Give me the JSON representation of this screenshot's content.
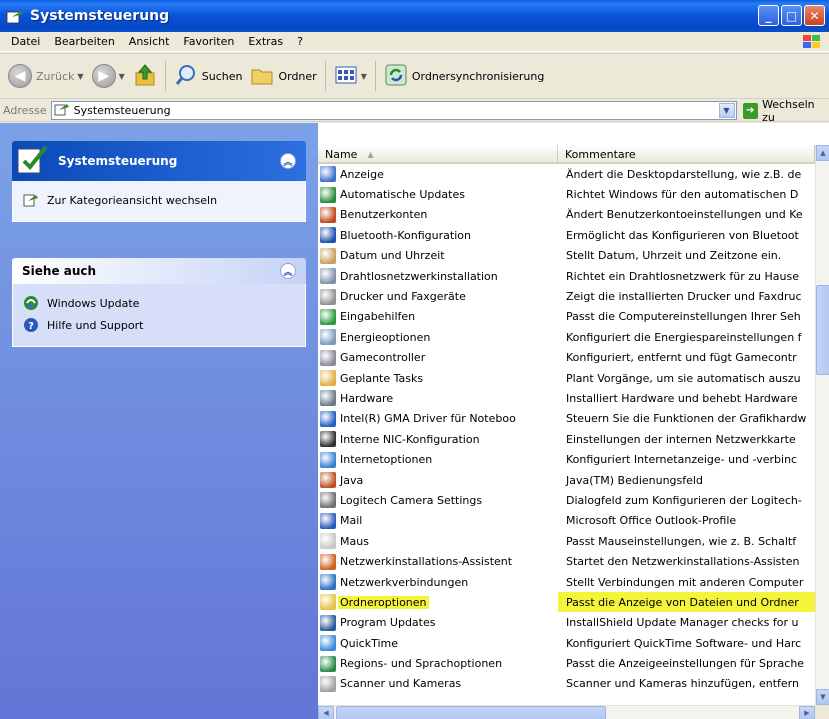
{
  "window": {
    "title": "Systemsteuerung"
  },
  "menu": [
    "Datei",
    "Bearbeiten",
    "Ansicht",
    "Favoriten",
    "Extras",
    "?"
  ],
  "toolbar": {
    "back": "Zurück",
    "search": "Suchen",
    "folders": "Ordner",
    "sync": "Ordnersynchronisierung"
  },
  "address": {
    "label": "Adresse",
    "value": "Systemsteuerung",
    "go": "Wechseln zu"
  },
  "leftpane": {
    "panel1": {
      "title": "Systemsteuerung",
      "link": "Zur Kategorieansicht wechseln"
    },
    "panel2": {
      "title": "Siehe auch",
      "links": [
        "Windows Update",
        "Hilfe und Support"
      ]
    }
  },
  "columns": {
    "name": "Name",
    "comment": "Kommentare"
  },
  "items": [
    {
      "name": "Anzeige",
      "comment": "Ändert die Desktopdarstellung, wie z.B. de",
      "icon": "display-icon",
      "color": "#3a6fd0"
    },
    {
      "name": "Automatische Updates",
      "comment": "Richtet Windows für den automatischen D",
      "icon": "updates-icon",
      "color": "#2a8a3a"
    },
    {
      "name": "Benutzerkonten",
      "comment": "Ändert Benutzerkontoeinstellungen und Ke",
      "icon": "users-icon",
      "color": "#c04a20"
    },
    {
      "name": "Bluetooth-Konfiguration",
      "comment": "Ermöglicht das Konfigurieren von Bluetoot",
      "icon": "bluetooth-icon",
      "color": "#1f4fb0"
    },
    {
      "name": "Datum und Uhrzeit",
      "comment": "Stellt Datum, Uhrzeit und Zeitzone ein.",
      "icon": "clock-icon",
      "color": "#c8a060"
    },
    {
      "name": "Drahtlosnetzwerkinstallation",
      "comment": "Richtet ein Drahtlosnetzwerk für zu Hause",
      "icon": "wireless-icon",
      "color": "#8090a8"
    },
    {
      "name": "Drucker und Faxgeräte",
      "comment": "Zeigt die installierten Drucker und Faxdruc",
      "icon": "printer-icon",
      "color": "#909090"
    },
    {
      "name": "Eingabehilfen",
      "comment": "Passt die Computereinstellungen Ihrer Seh",
      "icon": "accessibility-icon",
      "color": "#2a9a40"
    },
    {
      "name": "Energieoptionen",
      "comment": "Konfiguriert die Energiespareinstellungen f",
      "icon": "power-icon",
      "color": "#7a9ab8"
    },
    {
      "name": "Gamecontroller",
      "comment": "Konfiguriert, entfernt und fügt Gamecontr",
      "icon": "gamepad-icon",
      "color": "#8a8a9a"
    },
    {
      "name": "Geplante Tasks",
      "comment": "Plant Vorgänge, um sie automatisch auszu",
      "icon": "tasks-icon",
      "color": "#e0b040"
    },
    {
      "name": "Hardware",
      "comment": "Installiert Hardware und behebt Hardware",
      "icon": "hardware-icon",
      "color": "#6a7a8a"
    },
    {
      "name": "Intel(R) GMA Driver für Noteboo",
      "comment": "Steuern Sie die Funktionen der Grafikhardw",
      "icon": "intel-icon",
      "color": "#2060c0"
    },
    {
      "name": "Interne NIC-Konfiguration",
      "comment": "Einstellungen der internen Netzwerkkarte",
      "icon": "network-card-icon",
      "color": "#303030"
    },
    {
      "name": "Internetoptionen",
      "comment": "Konfiguriert Internetanzeige- und -verbinc",
      "icon": "internet-icon",
      "color": "#3a80d0"
    },
    {
      "name": "Java",
      "comment": "Java(TM) Bedienungsfeld",
      "icon": "java-icon",
      "color": "#c05020"
    },
    {
      "name": "Logitech Camera Settings",
      "comment": "Dialogfeld zum Konfigurieren der Logitech-",
      "icon": "camera-icon",
      "color": "#707070"
    },
    {
      "name": "Mail",
      "comment": "Microsoft Office Outlook-Profile",
      "icon": "mail-icon",
      "color": "#2a5ab8"
    },
    {
      "name": "Maus",
      "comment": "Passt Mauseinstellungen, wie z. B. Schaltf",
      "icon": "mouse-icon",
      "color": "#c8c8c8"
    },
    {
      "name": "Netzwerkinstallations-Assistent",
      "comment": "Startet den Netzwerkinstallations-Assisten",
      "icon": "network-wizard-icon",
      "color": "#d06020"
    },
    {
      "name": "Netzwerkverbindungen",
      "comment": "Stellt Verbindungen mit anderen Computer",
      "icon": "network-icon",
      "color": "#2a70c8"
    },
    {
      "name": "Ordneroptionen",
      "comment": "Passt die Anzeige von Dateien und Ordner",
      "icon": "folder-icon",
      "color": "#e8c040",
      "selected": true
    },
    {
      "name": "Program Updates",
      "comment": "InstallShield Update Manager checks for u",
      "icon": "program-updates-icon",
      "color": "#2a5a9a"
    },
    {
      "name": "QuickTime",
      "comment": "Konfiguriert QuickTime Software- und Harc",
      "icon": "quicktime-icon",
      "color": "#3a8ad8"
    },
    {
      "name": "Regions- und Sprachoptionen",
      "comment": "Passt die Anzeigeeinstellungen für Sprache",
      "icon": "globe-icon",
      "color": "#2a8a4a"
    },
    {
      "name": "Scanner und Kameras",
      "comment": "Scanner und Kameras hinzufügen, entfern",
      "icon": "scanner-icon",
      "color": "#a0a0a0"
    }
  ]
}
